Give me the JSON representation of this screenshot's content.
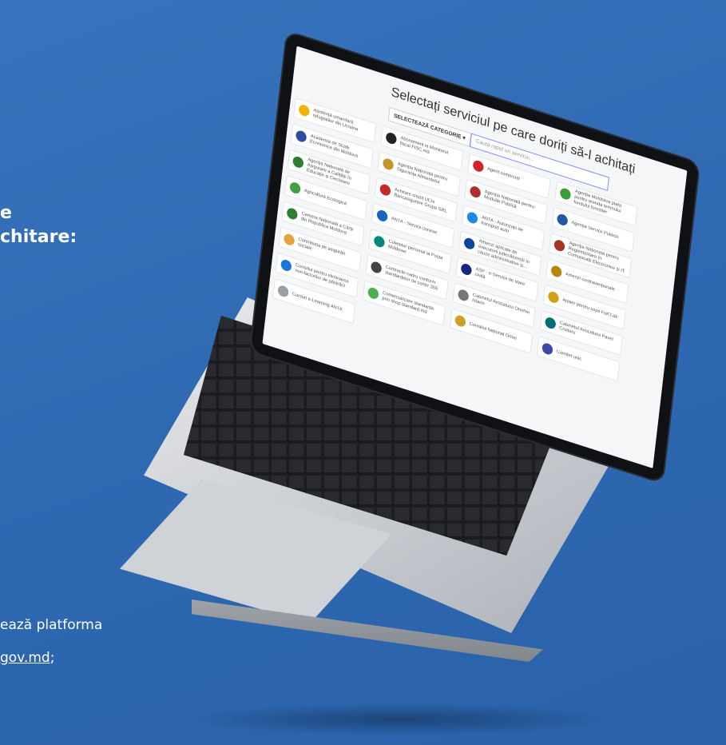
{
  "left_panel": {
    "heading_line1": "e",
    "heading_line2": "chitare:",
    "footer_line1": "ează platforma",
    "footer_link": "gov.md",
    "footer_link_suffix": ";"
  },
  "screen": {
    "title": "Selectați serviciul pe care doriți să-l achitați",
    "category_button": "SELECTEAZĂ CATEGORIE ▾",
    "search_placeholder": "Caută rapid un serviciu...",
    "cards": [
      {
        "label": "Asistență umanitară refugiaților din Ucraina",
        "color": "#f0b400"
      },
      {
        "label": "Abonament la Monitorul fiscal FISC.md",
        "color": "#222222"
      },
      {
        "label": "Agent comercial",
        "color": "#d3232b"
      },
      {
        "label": "Agenția Moldsilva plata pentru arenda terenului fondului forestier",
        "color": "#3a9b3a"
      },
      {
        "label": "Academia de Studii Economice din Moldova",
        "color": "#2a4ea0"
      },
      {
        "label": "Agenția Națională pentru Siguranța Alimentelor",
        "color": "#c8952b"
      },
      {
        "label": "Agenția Națională pentru Modulăr Publică",
        "color": "#b22d2d"
      },
      {
        "label": "Agenția Servicii Publice",
        "color": "#1f5aa6"
      },
      {
        "label": "Agenția Națională de Asigurare a Calității în Educație și Cercetare",
        "color": "#2e7d32"
      },
      {
        "label": "Achitare credit UCIs Bancasigurare Grupa SRL",
        "color": "#c62828"
      },
      {
        "label": "ANTA - Autorizații de transport auto",
        "color": "#1e88e5"
      },
      {
        "label": "Agenția Națională pentru Reglementare în Comunicații Electronice și IT",
        "color": "#a93226"
      },
      {
        "label": "Agricultură Ecologică",
        "color": "#43a047"
      },
      {
        "label": "ANTA - Servicii conexe",
        "color": "#1565c0"
      },
      {
        "label": "Amenzi aplicate de executorii judecătorești în cauze administrative și...",
        "color": "#0d47a1"
      },
      {
        "label": "Amenzi contravenționale",
        "color": "#b8860b"
      },
      {
        "label": "Camera Națională a Cărții din Republica Moldova",
        "color": "#2e7d32"
      },
      {
        "label": "Coletelor personal la Poșta Moldovei",
        "color": "#00897b"
      },
      {
        "label": "ASP - e-Servicii de stare civilă",
        "color": "#1a237e"
      },
      {
        "label": "Atelier pentru copii FuKT.dk",
        "color": "#d4a017"
      },
      {
        "label": "Contribuția de asigurări sociale",
        "color": "#e6a23c"
      },
      {
        "label": "Contracte-cadru conform standardelor tie contrr 355",
        "color": "#444444"
      },
      {
        "label": "Cabinetul Avocatului Onofrei Istarin",
        "color": "#777777"
      },
      {
        "label": "Cabinetul Avocatului Pavel Croitoru",
        "color": "#006d77"
      },
      {
        "label": "Consiliul pentru eliminarea non-factorilor de păstrării",
        "color": "#1976d2"
      },
      {
        "label": "Comercializare standarde prin shop.standard.md",
        "color": "#4caf50"
      },
      {
        "label": "Consiliul Național Orhei",
        "color": "#c9a227"
      },
      {
        "label": "Comitet unic",
        "color": "#3949ab"
      },
      {
        "label": "Cursuri e-Learning ANTA",
        "color": "#9aa0a6"
      }
    ]
  },
  "colors": {
    "background": "#2f6cb5",
    "screen_bg": "#f5f6f8",
    "accent": "#7a8cff"
  }
}
